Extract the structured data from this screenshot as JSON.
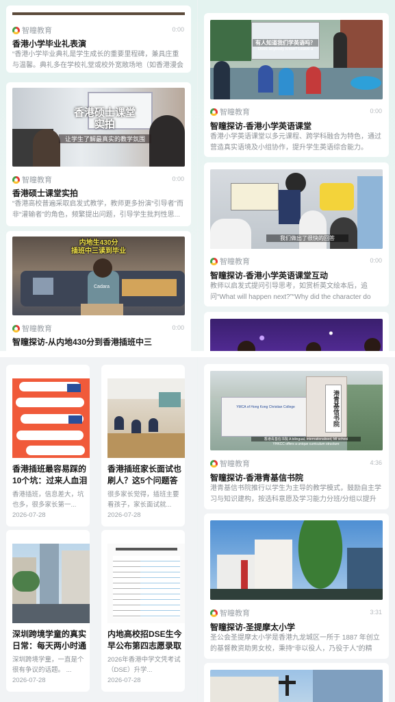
{
  "source_name": "智瞳教育",
  "top_left": {
    "cards": [
      {
        "duration": "0:00",
        "title": "香港小学毕业礼表演",
        "desc": "“香港小学毕业典礼是学生成长的重要里程碑，兼具庄重与温馨。典礼多在学校礼堂或校外宽敞场地（如香港漫会大..."
      },
      {
        "duration": "0:00",
        "title": "香港硕士课堂实拍",
        "desc": "“香港高校普遍采取启发式教学，教师更多扮演“引导者”而非“灌输者”的角色，频繁提出问题，引导学生批判性思...",
        "thumb_title": "香港硕士课堂\n实拍",
        "thumb_sub": "让学生了解最真实的教学氛围"
      },
      {
        "duration": "0:00",
        "title": "智瞳探访-从内地430分到香港插班中三",
        "thumb_title": "内地生430分\n插班中三读到毕业",
        "thumb_cap": "Cadara"
      }
    ]
  },
  "top_right": {
    "cards": [
      {
        "duration": "0:00",
        "title": "智瞳探访-香港小学英语课堂",
        "desc": "香港小学英语课堂以多元课程、跨学科融合为特色，通过营造真实语境及小组协作，提升学生英语综合能力。",
        "thumb_screen": "有人知道我们学英语吗？",
        "thumb_screen2": "Does anybody know? Leave a"
      },
      {
        "duration": "0:00",
        "title": "智瞳探访-香港小学英语课堂互动",
        "desc": "教师以启发式提问引导思考，如赏析英文绘本后，追问“What will happen next?”“Why did the character do tha...",
        "thumb_sub": "我们做出了很快的回答"
      },
      {
        "duration": "",
        "title": ""
      }
    ]
  },
  "bottom_left": {
    "cards": [
      {
        "title": "香港插班最容易踩的10个坑：过来人血泪教...",
        "desc": "香港插班，信息差大，坑也多，很多家长第一...",
        "date": "2026-07-28"
      },
      {
        "title": "香港插班家长面试也刷人？这5个问题答错...",
        "desc": "很多家长觉得，插班主要看孩子，家长面试就...",
        "date": "2026-07-28"
      },
      {
        "title": "深圳跨境学童的真实日常：每天两小时通勤...",
        "desc": "深圳跨境学童，一直是个很有争议的话题。 ...",
        "date": "2026-07-28"
      },
      {
        "title": "内地高校招DSE生今早公布第四志愿录取结...",
        "desc": "2026年香港中学文凭考试（DSE）升学...",
        "date": "2026-07-28"
      }
    ]
  },
  "bottom_right": {
    "cards": [
      {
        "duration": "4:36",
        "title": "智瞳探访-香港青基信书院",
        "desc": "港青基信书院推行以学生为主导的教学模式，鼓励自主学习与知识建构，按选科意愿及学习能力分班/分组以提升效...",
        "thumb_sign": "港青基信书院",
        "thumb_en": "YMCA of Hong Kong Christian College",
        "thumb_sub": "香港青基信书院 A bilingual, internationalised, MI school",
        "thumb_sub2": "YHKCC offers a unique curriculum structure"
      },
      {
        "duration": "3:31",
        "title": "智瞳探访-圣提摩太小学",
        "desc": "圣公会圣提摩太小学是香港九龙城区一所于 1887 年创立的基督教资助男女校，秉持“非以役人，乃役于人”的精神..."
      },
      {
        "duration": "",
        "title": ""
      }
    ]
  },
  "colors": {
    "accent": "#43a047",
    "title": "#1a1a1a",
    "muted": "#8c9196"
  }
}
